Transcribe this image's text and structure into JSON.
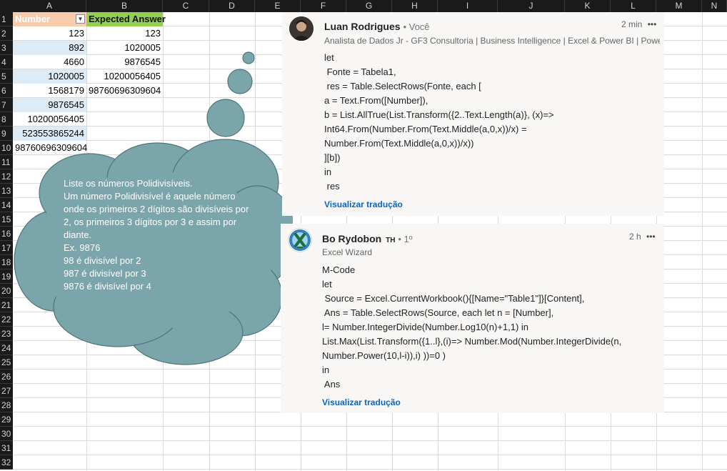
{
  "columns": [
    "A",
    "B",
    "C",
    "D",
    "E",
    "F",
    "G",
    "H",
    "I",
    "J",
    "K",
    "L",
    "M",
    "N"
  ],
  "rows": [
    "1",
    "2",
    "3",
    "4",
    "5",
    "6",
    "7",
    "8",
    "9",
    "10",
    "11",
    "12",
    "13",
    "14",
    "15",
    "16",
    "17",
    "18",
    "19",
    "20",
    "21",
    "22",
    "23",
    "24",
    "25",
    "26",
    "27",
    "28",
    "29",
    "30",
    "31",
    "32"
  ],
  "table": {
    "header_a": "Number",
    "header_b": "Expected Answer",
    "numbers": [
      "123",
      "892",
      "4660",
      "1020005",
      "1568179",
      "9876545",
      "10200056405",
      "523553865244",
      "98760696309604"
    ],
    "answers": [
      "123",
      "1020005",
      "9876545",
      "10200056405",
      "98760696309604"
    ]
  },
  "cloud": {
    "lines": [
      "Liste os números Polidivisíveis.",
      "Um número Polidivisível é aquele número",
      "onde os primeiros 2 dígitos são divisíveis por",
      "2, os primeiros 3 dígitos por 3 e assim por",
      "diante.",
      "Ex. 9876",
      "98 é divisível por 2",
      "987 é divisível por 3",
      "9876 é divisível por 4"
    ]
  },
  "comments": [
    {
      "author": "Luan Rodrigues",
      "relation": "• Você",
      "headline": "Analista de Dados Jr - GF3 Consultoria | Business Intelligence | Excel & Power BI | Powe...",
      "time": "2 min",
      "more": "•••",
      "code": [
        "let",
        " Fonte = Tabela1,",
        " res = Table.SelectRows(Fonte, each [",
        "a = Text.From([Number]),",
        "b = List.AllTrue(List.Transform({2..Text.Length(a)}, (x)=>",
        "Int64.From(Number.From(Text.Middle(a,0,x))/x) =",
        "Number.From(Text.Middle(a,0,x))/x))",
        "][b])",
        "in",
        " res"
      ],
      "translate": "Visualizar tradução"
    },
    {
      "author": "Bo Rydobon",
      "badge": "TH",
      "relation": "• 1º",
      "headline": "Excel Wizard",
      "time": "2 h",
      "more": "•••",
      "code": [
        "M-Code",
        "let",
        " Source = Excel.CurrentWorkbook(){[Name=\"Table1\"]}[Content],",
        " Ans = Table.SelectRows(Source, each let n = [Number],",
        "l= Number.IntegerDivide(Number.Log10(n)+1,1) in",
        "List.Max(List.Transform({1..l},(i)=> Number.Mod(Number.IntegerDivide(n,",
        "Number.Power(10,l-i)),i) ))=0 )",
        "in",
        " Ans"
      ],
      "translate": "Visualizar tradução"
    }
  ],
  "colors": {
    "header_a": "#f8cbad",
    "header_b": "#92d050",
    "band": "#ddebf7",
    "cloud": "#7aa6ab",
    "link": "#0a66c2"
  }
}
